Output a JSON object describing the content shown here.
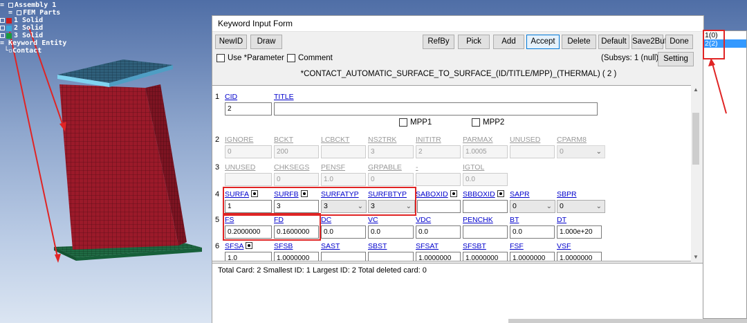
{
  "tree": {
    "assembly": "Assembly 1",
    "fem_parts": "FEM Parts",
    "parts": [
      {
        "label": "1 Solid",
        "color": "#cc1f1f"
      },
      {
        "label": "2 Solid",
        "color": "#3aa6d9"
      },
      {
        "label": "3 Solid",
        "color": "#1a9a3c"
      }
    ],
    "keyword_entity": "Keyword Entity",
    "contact": "Contact"
  },
  "window": {
    "title": "Keyword Input Form",
    "buttons": {
      "newid": "NewID",
      "draw": "Draw",
      "refby": "RefBy",
      "pick": "Pick",
      "add": "Add",
      "accept": "Accept",
      "delete": "Delete",
      "default": "Default",
      "save2buf": "Save2Buf",
      "done": "Done",
      "setting": "Setting"
    },
    "use_parameter": "Use *Parameter",
    "comment": "Comment",
    "subsys": "(Subsys: 1 (null))",
    "keyword_header": "*CONTACT_AUTOMATIC_SURFACE_TO_SURFACE_(ID/TITLE/MPP)_(THERMAL)   ( 2 )"
  },
  "cards": {
    "row1": {
      "num": "1",
      "cid_label": "CID",
      "title_label": "TITLE",
      "cid_value": "2",
      "title_value": ""
    },
    "mpp1": "MPP1",
    "mpp2": "MPP2",
    "row2": {
      "num": "2",
      "labels": [
        "IGNORE",
        "BCKT",
        "LCBCKT",
        "NS2TRK",
        "INITITR",
        "PARMAX",
        "UNUSED",
        "CPARM8"
      ],
      "values": [
        "0",
        "200",
        "",
        "3",
        "2",
        "1.0005",
        "",
        "0"
      ]
    },
    "row3": {
      "num": "3",
      "labels": [
        "UNUSED",
        "CHKSEGS",
        "PENSF",
        "GRPABLE",
        "-",
        "IGTOL"
      ],
      "values": [
        "",
        "0",
        "1.0",
        "0",
        "",
        "0.0"
      ]
    },
    "row4": {
      "num": "4",
      "labels": [
        "SURFA",
        "SURFB",
        "SURFATYP",
        "SURFBTYP",
        "SABOXID",
        "SBBOXID",
        "SAPR",
        "SBPR"
      ],
      "values": [
        "1",
        "3",
        "3",
        "3",
        "",
        "",
        "0",
        "0"
      ]
    },
    "row5": {
      "num": "5",
      "labels": [
        "FS",
        "FD",
        "DC",
        "VC",
        "VDC",
        "PENCHK",
        "BT",
        "DT"
      ],
      "values": [
        "0.2000000",
        "0.1600000",
        "0.0",
        "0.0",
        "0.0",
        "",
        "0.0",
        "1.000e+20"
      ]
    },
    "row6": {
      "num": "6",
      "labels": [
        "SFSA",
        "SFSB",
        "SAST",
        "SBST",
        "SFSAT",
        "SFSBT",
        "FSF",
        "VSF"
      ],
      "values": [
        "1.0",
        "1.0000000",
        "",
        "",
        "1.0000000",
        "1.0000000",
        "1.0000000",
        "1.0000000"
      ]
    }
  },
  "status": {
    "text": "Total Card: 2    Smallest ID: 1    Largest ID: 2    Total deleted card:  0"
  },
  "id_list": {
    "items": [
      "1(0)",
      "2(2)"
    ],
    "selected_index": 1
  },
  "colors": {
    "mesh_red": "#9b1a2a",
    "mesh_top": "#2f5f7a",
    "mesh_base": "#1f6a43",
    "highlight_red": "#e02424",
    "link_blue": "#0000cc",
    "selection_blue": "#3399ff"
  }
}
